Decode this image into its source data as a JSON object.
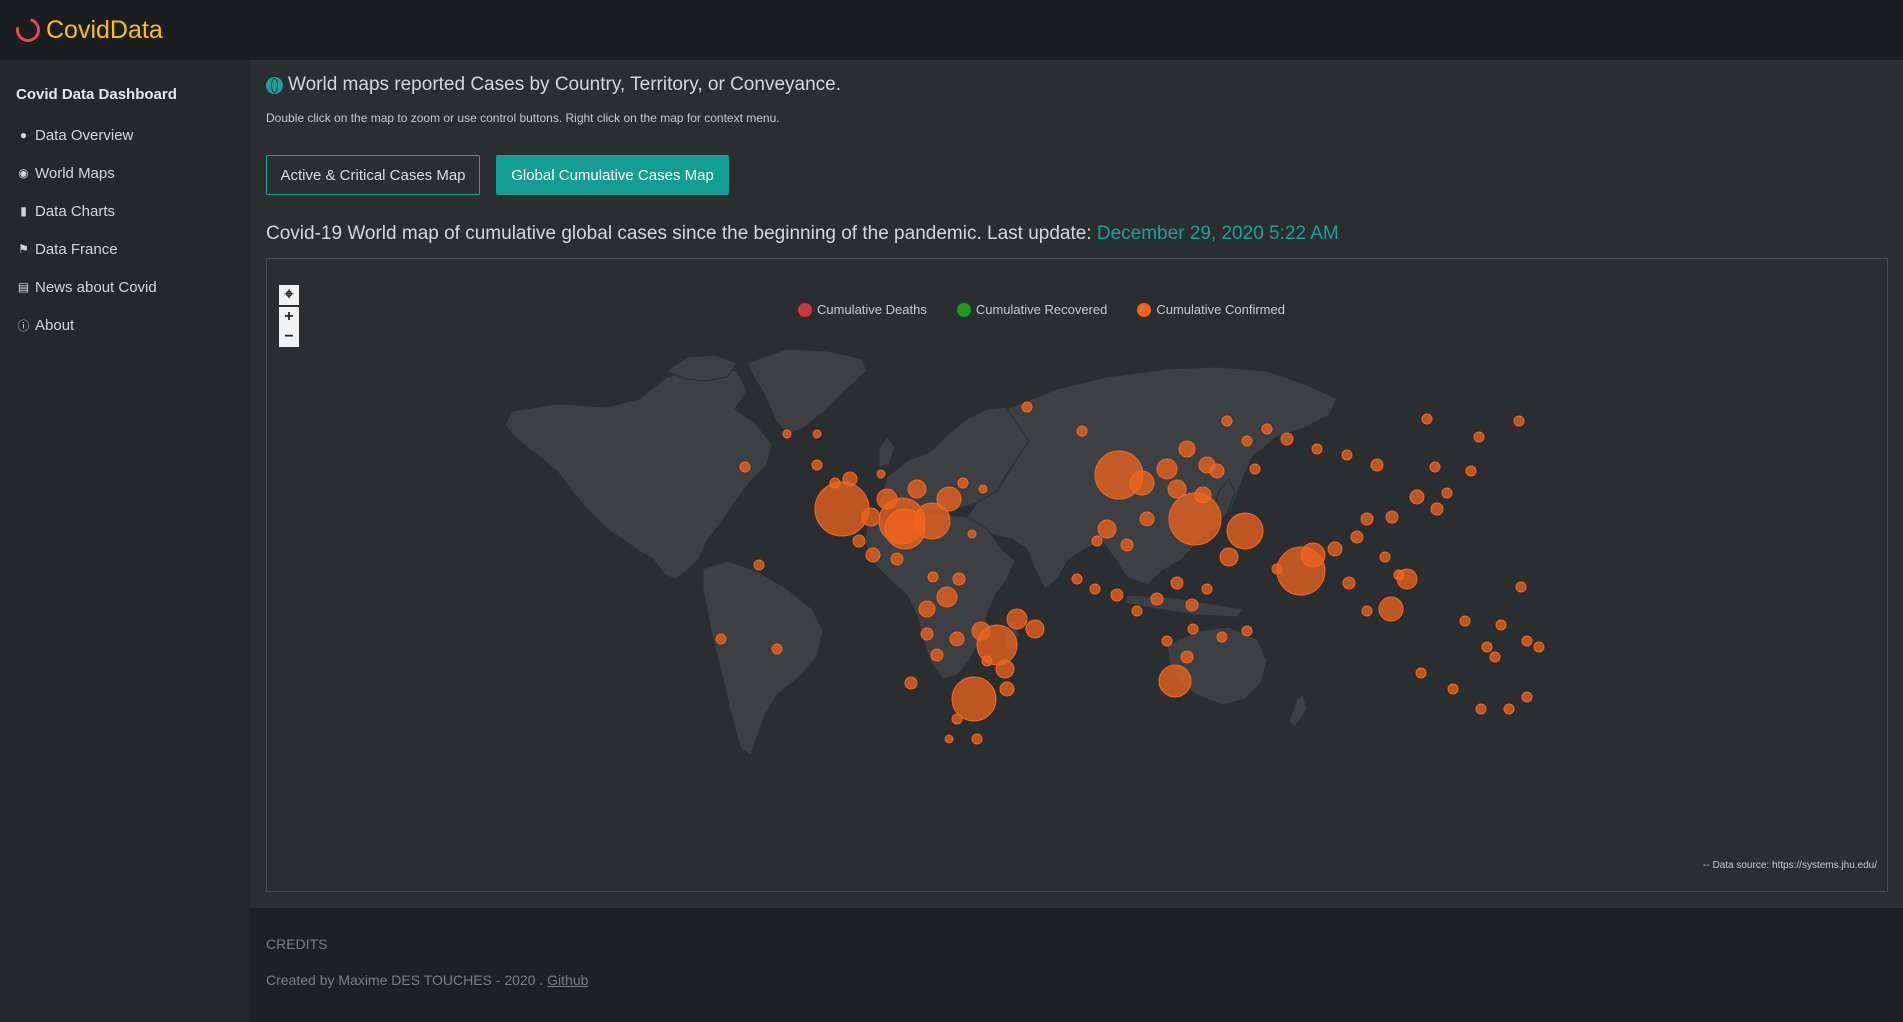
{
  "brand": {
    "name": "CovidData"
  },
  "sidebar": {
    "heading": "Covid Data Dashboard",
    "items": [
      {
        "label": "Data Overview",
        "icon": "binoculars-icon"
      },
      {
        "label": "World Maps",
        "icon": "globe-icon"
      },
      {
        "label": "Data Charts",
        "icon": "bar-chart-icon"
      },
      {
        "label": "Data France",
        "icon": "flag-icon"
      },
      {
        "label": "News about Covid",
        "icon": "newspaper-icon"
      },
      {
        "label": "About",
        "icon": "info-icon"
      }
    ]
  },
  "main": {
    "title": "World maps reported Cases by Country, Territory, or Conveyance.",
    "hint": "Double click on the map to zoom or use control buttons. Right click on the map for context menu.",
    "buttons": {
      "active": "Active & Critical Cases Map",
      "global": "Global Cumulative Cases Map"
    },
    "subtitle": "Covid-19 World map of cumulative global cases since the beginning of the pandemic. Last update:",
    "update_date": "December 29, 2020 5:22 AM"
  },
  "map": {
    "legend": [
      {
        "label": "Cumulative Deaths",
        "color": "#c9383a"
      },
      {
        "label": "Cumulative Recovered",
        "color": "#1e9b1e"
      },
      {
        "label": "Cumulative Confirmed",
        "color": "#f0641f"
      }
    ],
    "controls": {
      "reset": "⌖",
      "zoom_in": "+",
      "zoom_out": "−"
    },
    "source": "-- Data source: https://systems.jhu.edu/",
    "land_color": "#3d3f42",
    "bubble_color": "#f0641f"
  },
  "footer": {
    "credits": "CREDITS",
    "created": "Created by Maxime DES TOUCHES - 2020 .",
    "link": "Github"
  }
}
